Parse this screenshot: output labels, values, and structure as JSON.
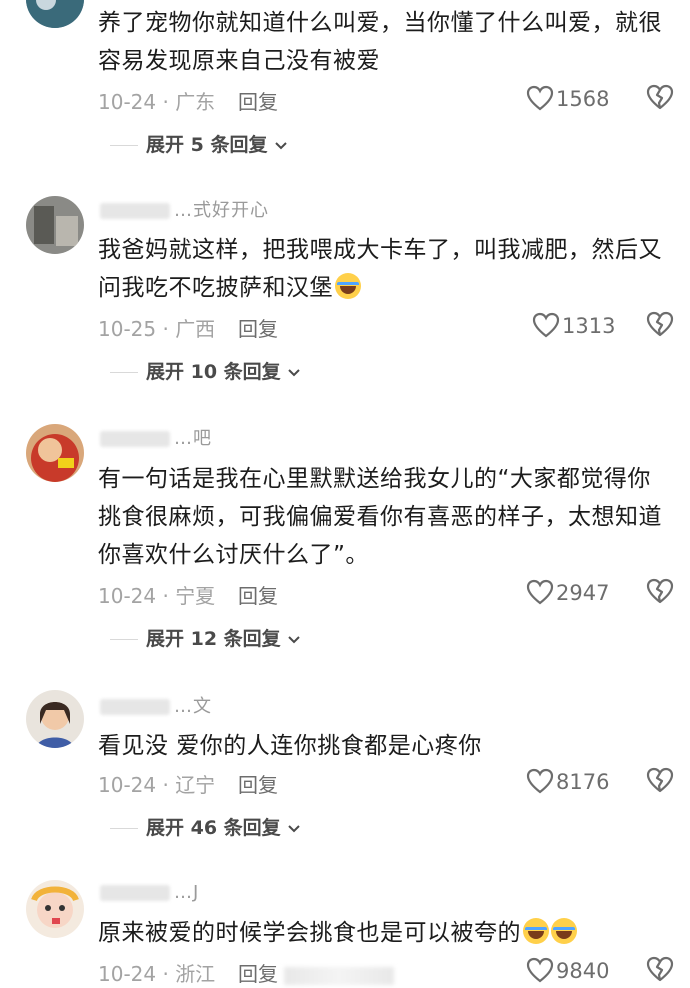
{
  "comments": [
    {
      "username": "",
      "text": "养了宠物你就知道什么叫爱，当你懂了什么叫爱，就很容易发现原来自己没有被爱",
      "date_location": "10-24 · 广东",
      "reply_label": "回复",
      "likes": "1568",
      "expand_label": "展开 5 条回复"
    },
    {
      "username": "…式好开心",
      "text": "我爸妈就这样，把我喂成大卡车了，叫我减肥，然后又问我吃不吃披萨和汉堡",
      "date_location": "10-25 · 广西",
      "reply_label": "回复",
      "likes": "1313",
      "expand_label": "展开 10 条回复"
    },
    {
      "username": "…吧",
      "text": "有一句话是我在心里默默送给我女儿的“大家都觉得你挑食很麻烦，可我偏偏爱看你有喜恶的样子，太想知道你喜欢什么讨厌什么了”。",
      "date_location": "10-24 · 宁夏",
      "reply_label": "回复",
      "likes": "2947",
      "expand_label": "展开 12 条回复"
    },
    {
      "username": "…文",
      "text": "看见没 爱你的人连你挑食都是心疼你",
      "date_location": "10-24 · 辽宁",
      "reply_label": "回复",
      "likes": "8176",
      "expand_label": "展开 46 条回复"
    },
    {
      "username": "…J",
      "text": "原来被爱的时候学会挑食也是可以被夸的",
      "date_location": "10-24 · 浙江",
      "reply_label": "回复",
      "likes": "9840",
      "expand_label": ""
    }
  ],
  "icons": {
    "like": "heart-outline-icon",
    "dislike": "broken-heart-icon",
    "chevron": "chevron-down-icon"
  },
  "colors": {
    "meta_text": "#a3a3a3",
    "body_text": "#1c1c1c"
  }
}
